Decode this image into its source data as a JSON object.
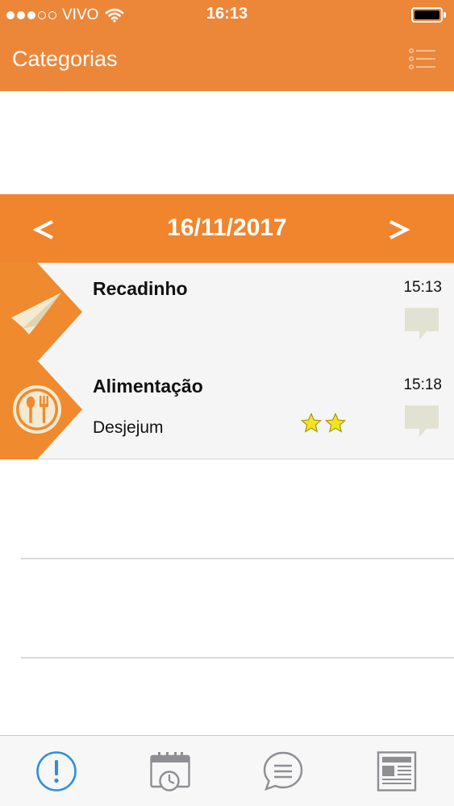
{
  "status_bar": {
    "carrier": "VIVO",
    "time": "16:13"
  },
  "header": {
    "title": "Categorias",
    "menu_icon": "list-icon"
  },
  "date_nav": {
    "date": "16/11/2017",
    "prev_label": "<",
    "next_label": ">"
  },
  "entries": [
    {
      "title": "Recadinho",
      "time": "15:13",
      "subtitle": "",
      "icon": "paper-plane-icon",
      "stars": 0
    },
    {
      "title": "Alimentação",
      "time": "15:18",
      "subtitle": "Desjejum",
      "icon": "spoon-fork-icon",
      "stars": 2
    }
  ],
  "colors": {
    "accent": "#ec873a",
    "date_bar": "#f0852d",
    "tag": "#ef8a2f",
    "tab_active": "#2d8fe0",
    "tab_inactive": "#8e8e93",
    "comment": "#e2e2d2",
    "star": "#f4e41e"
  },
  "tab_bar": {
    "tabs": [
      {
        "icon": "exclamation-circle-icon",
        "active": true
      },
      {
        "icon": "calendar-clock-icon",
        "active": false
      },
      {
        "icon": "chat-bubble-icon",
        "active": false
      },
      {
        "icon": "newspaper-icon",
        "active": false
      }
    ]
  }
}
